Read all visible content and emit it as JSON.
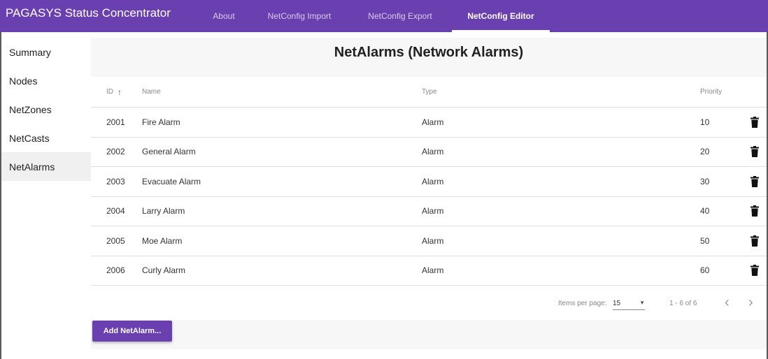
{
  "app": {
    "title": "PAGASYS Status Concentrator"
  },
  "nav": {
    "tabs": [
      {
        "label": "About",
        "active": false
      },
      {
        "label": "NetConfig Import",
        "active": false
      },
      {
        "label": "NetConfig Export",
        "active": false
      },
      {
        "label": "NetConfig Editor",
        "active": true
      }
    ]
  },
  "sidebar": {
    "items": [
      {
        "label": "Summary",
        "active": false
      },
      {
        "label": "Nodes",
        "active": false
      },
      {
        "label": "NetZones",
        "active": false
      },
      {
        "label": "NetCasts",
        "active": false
      },
      {
        "label": "NetAlarms",
        "active": true
      }
    ]
  },
  "page": {
    "title": "NetAlarms (Network Alarms)"
  },
  "table": {
    "headers": {
      "id": "ID",
      "name": "Name",
      "type": "Type",
      "priority": "Priority"
    },
    "sort": {
      "column": "ID",
      "direction": "ascending",
      "icon": "arrow-up-icon"
    },
    "rows": [
      {
        "id": "2001",
        "name": "Fire Alarm",
        "type": "Alarm",
        "priority": "10"
      },
      {
        "id": "2002",
        "name": "General Alarm",
        "type": "Alarm",
        "priority": "20"
      },
      {
        "id": "2003",
        "name": "Evacuate Alarm",
        "type": "Alarm",
        "priority": "30"
      },
      {
        "id": "2004",
        "name": "Larry Alarm",
        "type": "Alarm",
        "priority": "40"
      },
      {
        "id": "2005",
        "name": "Moe Alarm",
        "type": "Alarm",
        "priority": "50"
      },
      {
        "id": "2006",
        "name": "Curly Alarm",
        "type": "Alarm",
        "priority": "60"
      }
    ],
    "row_action_icon": "trash-icon"
  },
  "paginator": {
    "items_per_page_label": "Items per page:",
    "items_per_page": "15",
    "range_label": "1 - 6 of 6",
    "prev_icon": "chevron-left-icon",
    "next_icon": "chevron-right-icon"
  },
  "actions": {
    "add_label": "Add NetAlarm..."
  },
  "colors": {
    "accent": "#6a3fb0",
    "header_band": "#f7f7f7",
    "sidebar_active": "#f0f0f0"
  }
}
